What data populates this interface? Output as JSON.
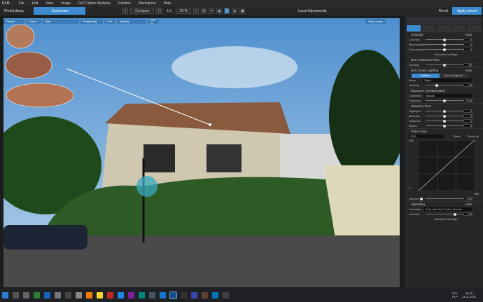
{
  "app": {
    "title": "PhotoLibrary",
    "customize": "Customize"
  },
  "menu": [
    "File",
    "Edit",
    "View",
    "Image",
    "DxO Optics Modules",
    "Palettes",
    "Workspace",
    "Help"
  ],
  "toolbar": {
    "compare": "Compare",
    "ratio": "1:1",
    "zoom": "29 %",
    "local": "Local Adjustments",
    "reset": "Reset",
    "apply": "Apply preset"
  },
  "repair": {
    "repair": "Repair",
    "clone": "Clone",
    "size": "Size",
    "feathering": "Feathering",
    "feather_val": "0 %",
    "opacity": "Opacity",
    "opacity_val": "100 %",
    "show_mask": "Show mask"
  },
  "panel": {
    "contrast": {
      "title": "Contrast",
      "auto": "Auto",
      "rows": [
        {
          "label": "Contrast",
          "val": "0"
        },
        {
          "label": "Microcontrast",
          "val": "0"
        },
        {
          "label": "Fine contrast",
          "val": "0"
        }
      ],
      "adv": "Advanced settings"
    },
    "clearview": {
      "title": "DxO ClearView Plus",
      "label": "Intensity",
      "val": "50"
    },
    "smart": {
      "title": "DxO Smart Lighting",
      "auto": "Auto",
      "uniform": "Uniform",
      "spot": "Spot Weighted",
      "mode_label": "Mode",
      "mode": "Slight",
      "intensity_label": "Intensity",
      "val": "25"
    },
    "exposure": {
      "title": "Exposure Compensation",
      "corr_label": "Correction",
      "corr": "Manual",
      "exp_label": "Exposure",
      "val": "0.00"
    },
    "tone": {
      "title": "Selective Tone",
      "rows": [
        {
          "label": "Highlights",
          "val": "0"
        },
        {
          "label": "Midtones",
          "val": "0"
        },
        {
          "label": "Shadows",
          "val": "0"
        },
        {
          "label": "Blacks",
          "val": "0"
        }
      ]
    },
    "curve": {
      "title": "Tone Curve",
      "channel": "RGB",
      "reset": "Reset",
      "reset_all": "Reset all",
      "top": "255",
      "zero": "0",
      "bottom": "255",
      "gamma_label": "Gamma",
      "gamma": "1.00"
    },
    "vignetting": {
      "title": "Vignetting",
      "auto": "Auto",
      "corr_label": "Correction",
      "corr": "Auto with DxO Optics Module",
      "int_label": "Intensity",
      "val": "100",
      "adv": "Advanced settings"
    }
  },
  "taskbar": {
    "lang": "POL",
    "layout": "PLP",
    "time": "16:33",
    "date": "14.01.2021"
  }
}
